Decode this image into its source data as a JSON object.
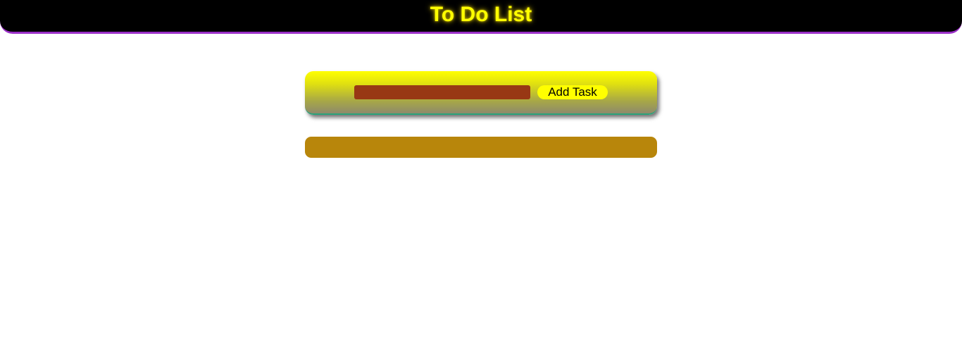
{
  "header": {
    "title": "To Do List"
  },
  "input_panel": {
    "task_input_value": "",
    "task_input_placeholder": "",
    "add_button_label": "Add Task"
  },
  "task_list": {
    "items": []
  },
  "colors": {
    "header_background": "#000000",
    "header_border": "#9b30c8",
    "title_color": "#ffff00",
    "panel_gradient_top": "#ffff00",
    "panel_gradient_bottom": "#8e8a6c",
    "panel_border": "#2aa37a",
    "task_input_background": "#983814",
    "add_button_background": "#ffff00",
    "task_list_background": "#b8860b"
  }
}
